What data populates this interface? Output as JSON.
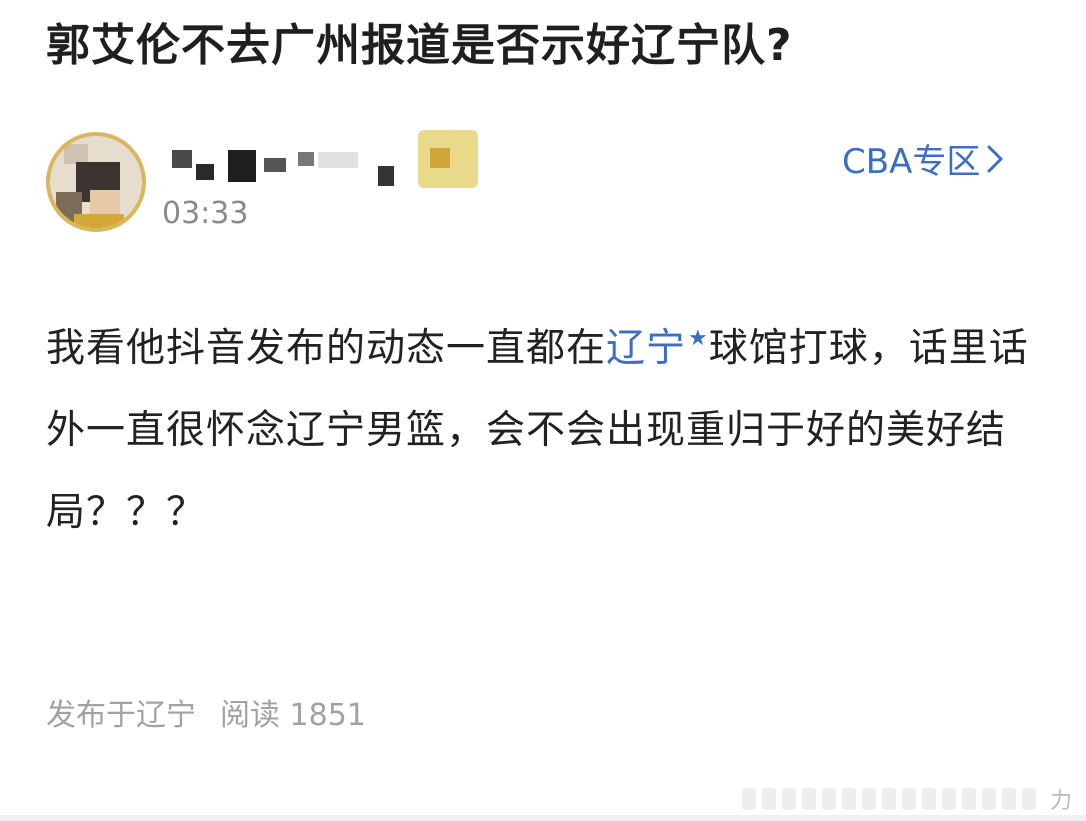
{
  "post": {
    "title": "郭艾伦不去广州报道是否示好辽宁队?",
    "time": "03:33",
    "topic_link": "CBA专区",
    "content_before": "我看他抖音发布的动态一直都在",
    "location_link": "辽宁",
    "content_after": "球馆打球，话里话外一直很怀念辽宁男篮，会不会出现重归于好的美好结局？？？",
    "published_location": "发布于辽宁",
    "reads": "阅读 1851",
    "watermark": "力"
  },
  "icons": {
    "topic_arrow": "chevron-right-icon",
    "location_marker": "star-icon"
  },
  "colors": {
    "link": "#3b6ec4",
    "title": "#1f1f1f",
    "meta": "#a2a2a2"
  }
}
